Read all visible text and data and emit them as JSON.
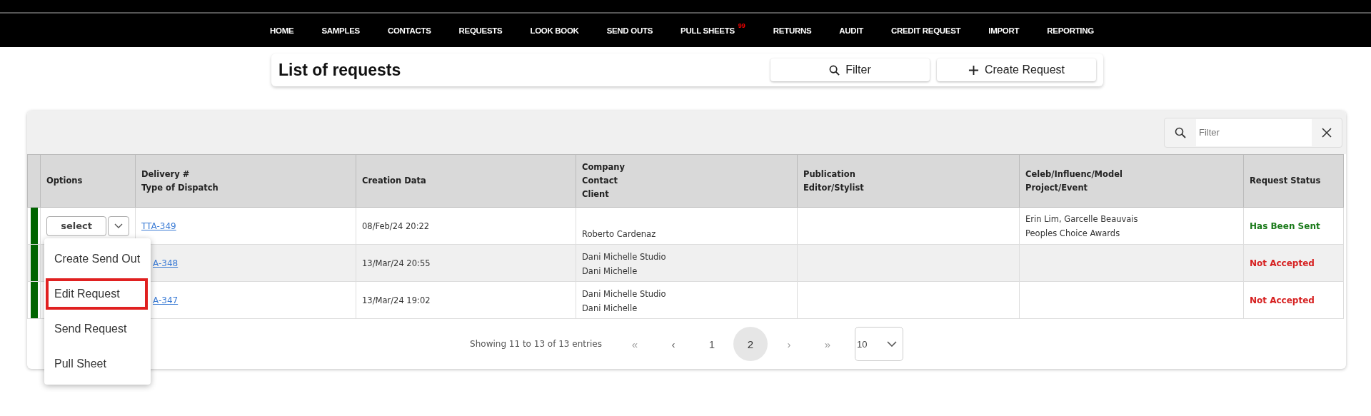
{
  "nav": {
    "items": [
      {
        "label": "HOME"
      },
      {
        "label": "SAMPLES"
      },
      {
        "label": "CONTACTS"
      },
      {
        "label": "REQUESTS"
      },
      {
        "label": "LOOK BOOK"
      },
      {
        "label": "SEND OUTS"
      },
      {
        "label": "PULL SHEETS",
        "badge": "99"
      },
      {
        "label": "RETURNS"
      },
      {
        "label": "AUDIT"
      },
      {
        "label": "CREDIT REQUEST"
      },
      {
        "label": "IMPORT"
      },
      {
        "label": "REPORTING"
      }
    ]
  },
  "header": {
    "title": "List of requests",
    "buttons": [
      {
        "kind": "filter",
        "label": "Filter"
      },
      {
        "kind": "create",
        "label": "Create Request"
      }
    ]
  },
  "table": {
    "search": {
      "placeholder": "Filter"
    },
    "columns": [
      {
        "lines": [
          "Options"
        ]
      },
      {
        "lines": [
          "Delivery #",
          "Type of Dispatch"
        ]
      },
      {
        "lines": [
          "Creation Data"
        ]
      },
      {
        "lines": [
          "Company",
          "Contact",
          "Client"
        ]
      },
      {
        "lines": [
          "Publication",
          "Editor/Stylist"
        ]
      },
      {
        "lines": [
          "Celeb/Influenc/Model",
          "Project/Event"
        ]
      },
      {
        "lines": [
          "Request Status"
        ]
      }
    ],
    "rows": [
      {
        "color": "#006400",
        "select_label": "select",
        "delivery": "TTA-349",
        "delivery_covered": false,
        "created": "08/Feb/24 20:22",
        "company": [
          "Roberto Cardenaz"
        ],
        "celeb": [
          "Erin Lim, Garcelle Beauvais",
          "Peoples Choice Awards"
        ],
        "status": "Has Been Sent",
        "kind": "sent"
      },
      {
        "color": "#006400",
        "delivery": "A-348",
        "delivery_covered": true,
        "created": "13/Mar/24 20:55",
        "company": [
          "Dani Michelle Studio",
          "Dani Michelle"
        ],
        "status": "Not Accepted",
        "kind": "rejected"
      },
      {
        "color": "#006400",
        "delivery": "A-347",
        "delivery_covered": true,
        "created": "13/Mar/24 19:02",
        "company": [
          "Dani Michelle Studio",
          "Dani Michelle"
        ],
        "status": "Not Accepted",
        "kind": "rejected"
      }
    ],
    "menu": [
      {
        "label": "Create Send Out",
        "selected": false
      },
      {
        "label": "Edit Request",
        "selected": true
      },
      {
        "label": "Send Request",
        "selected": false
      },
      {
        "label": "Pull Sheet",
        "selected": false
      }
    ],
    "pagination": {
      "info": "Showing 11 to 13 of 13 entries",
      "controls": [
        {
          "kind": "first",
          "label": "«"
        },
        {
          "kind": "prev",
          "label": "‹"
        },
        {
          "kind": "page",
          "label": "1",
          "selected": false
        },
        {
          "kind": "page",
          "label": "2",
          "selected": true
        },
        {
          "kind": "next",
          "label": "›"
        },
        {
          "kind": "last",
          "label": "»"
        }
      ],
      "page_size": "10"
    }
  }
}
